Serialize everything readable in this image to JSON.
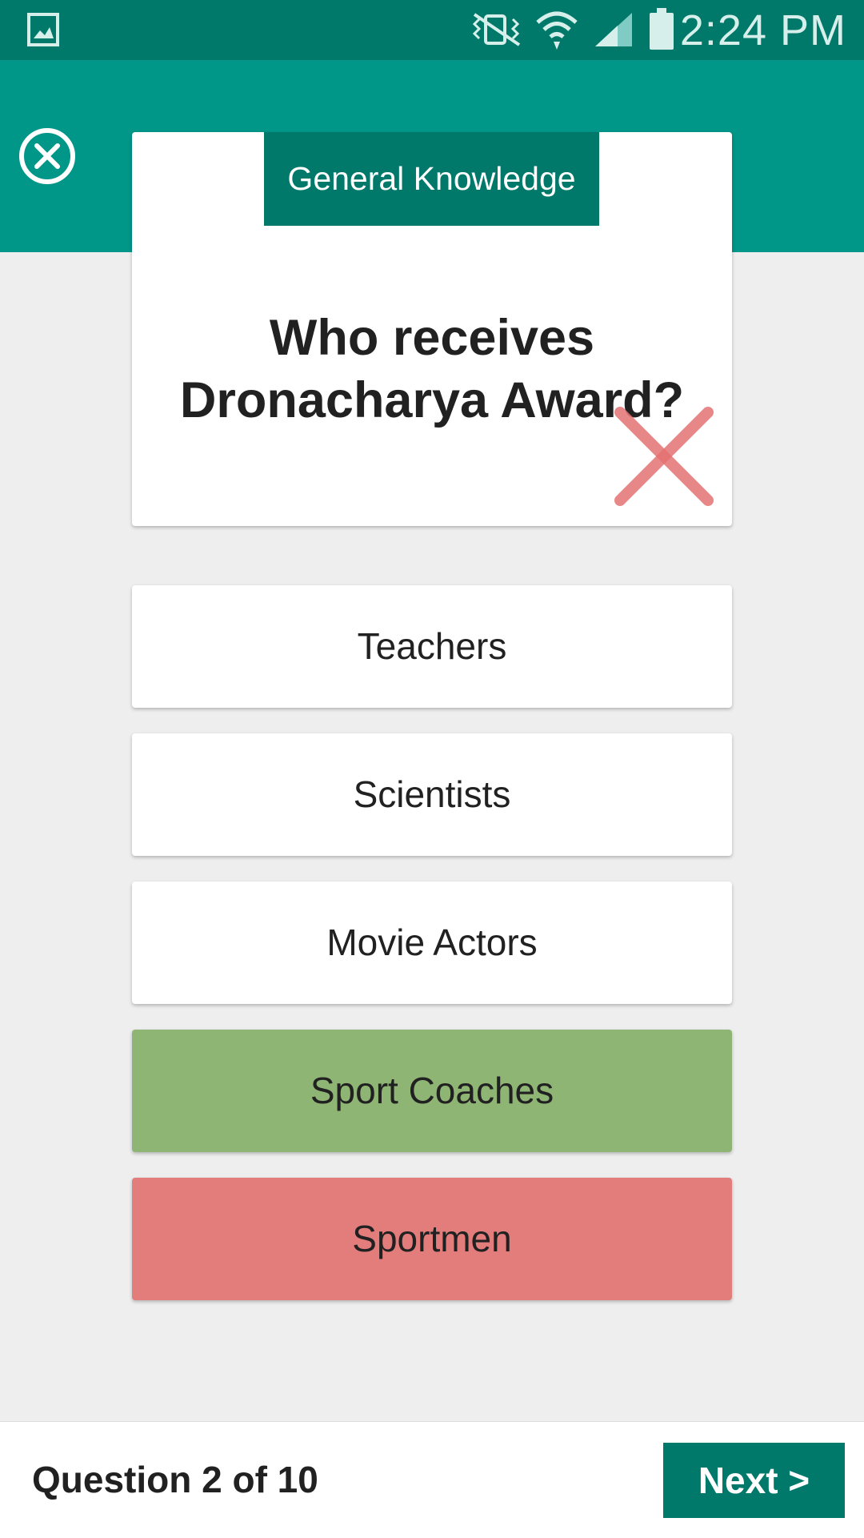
{
  "status_bar": {
    "time": "2:24 PM",
    "icons": [
      "gallery-notification-icon",
      "vibrate-icon",
      "wifi-icon",
      "signal-icon",
      "battery-icon"
    ]
  },
  "quiz": {
    "category": "General Knowledge",
    "question": "Who receives Dronacharya Award?",
    "answers": [
      {
        "label": "Teachers",
        "state": "neutral"
      },
      {
        "label": "Scientists",
        "state": "neutral"
      },
      {
        "label": "Movie Actors",
        "state": "neutral"
      },
      {
        "label": "Sport Coaches",
        "state": "correct"
      },
      {
        "label": "Sportmen",
        "state": "incorrect"
      }
    ]
  },
  "footer": {
    "progress": "Question 2 of 10",
    "next_label": "Next >"
  },
  "colors": {
    "primary": "#009688",
    "primary_dark": "#00796b",
    "correct": "#8fb575",
    "incorrect": "#e37d7c",
    "wrong_mark": "#e57373"
  }
}
